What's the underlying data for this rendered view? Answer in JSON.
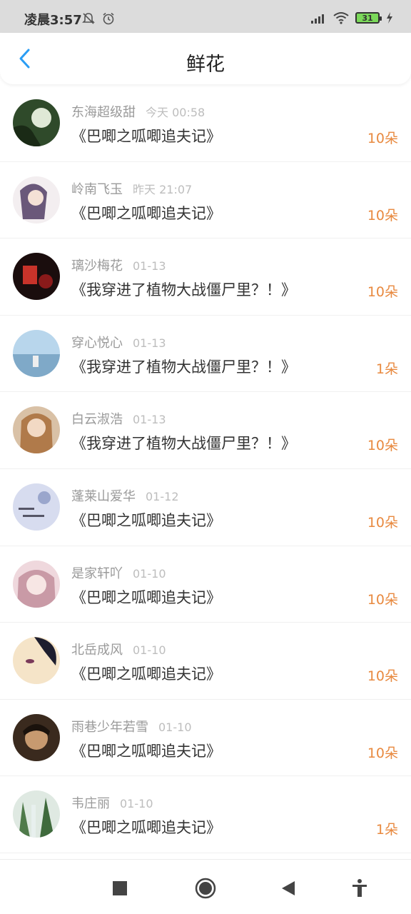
{
  "status": {
    "time": "凌晨3:57",
    "battery": "31"
  },
  "header": {
    "title": "鲜花"
  },
  "items": [
    {
      "name": "东海超级甜",
      "time": "今天 00:58",
      "book": "《巴唧之呱唧追夫记》",
      "count": "10朵"
    },
    {
      "name": "岭南飞玉",
      "time": "昨天 21:07",
      "book": "《巴唧之呱唧追夫记》",
      "count": "10朵"
    },
    {
      "name": "璃沙梅花",
      "time": "01-13",
      "book": "《我穿进了植物大战僵尸里？！》",
      "count": "10朵"
    },
    {
      "name": "穿心悦心",
      "time": "01-13",
      "book": "《我穿进了植物大战僵尸里？！》",
      "count": "1朵"
    },
    {
      "name": "白云淑浩",
      "time": "01-13",
      "book": "《我穿进了植物大战僵尸里？！》",
      "count": "10朵"
    },
    {
      "name": "蓬莱山爱华",
      "time": "01-12",
      "book": "《巴唧之呱唧追夫记》",
      "count": "10朵"
    },
    {
      "name": "是家轩吖",
      "time": "01-10",
      "book": "《巴唧之呱唧追夫记》",
      "count": "10朵"
    },
    {
      "name": "北岳成风",
      "time": "01-10",
      "book": "《巴唧之呱唧追夫记》",
      "count": "10朵"
    },
    {
      "name": "雨巷少年若雪",
      "time": "01-10",
      "book": "《巴唧之呱唧追夫记》",
      "count": "10朵"
    },
    {
      "name": "韦庄丽",
      "time": "01-10",
      "book": "《巴唧之呱唧追夫记》",
      "count": "1朵"
    }
  ],
  "colors": {
    "accent": "#e8893f",
    "back": "#2a9df4"
  }
}
